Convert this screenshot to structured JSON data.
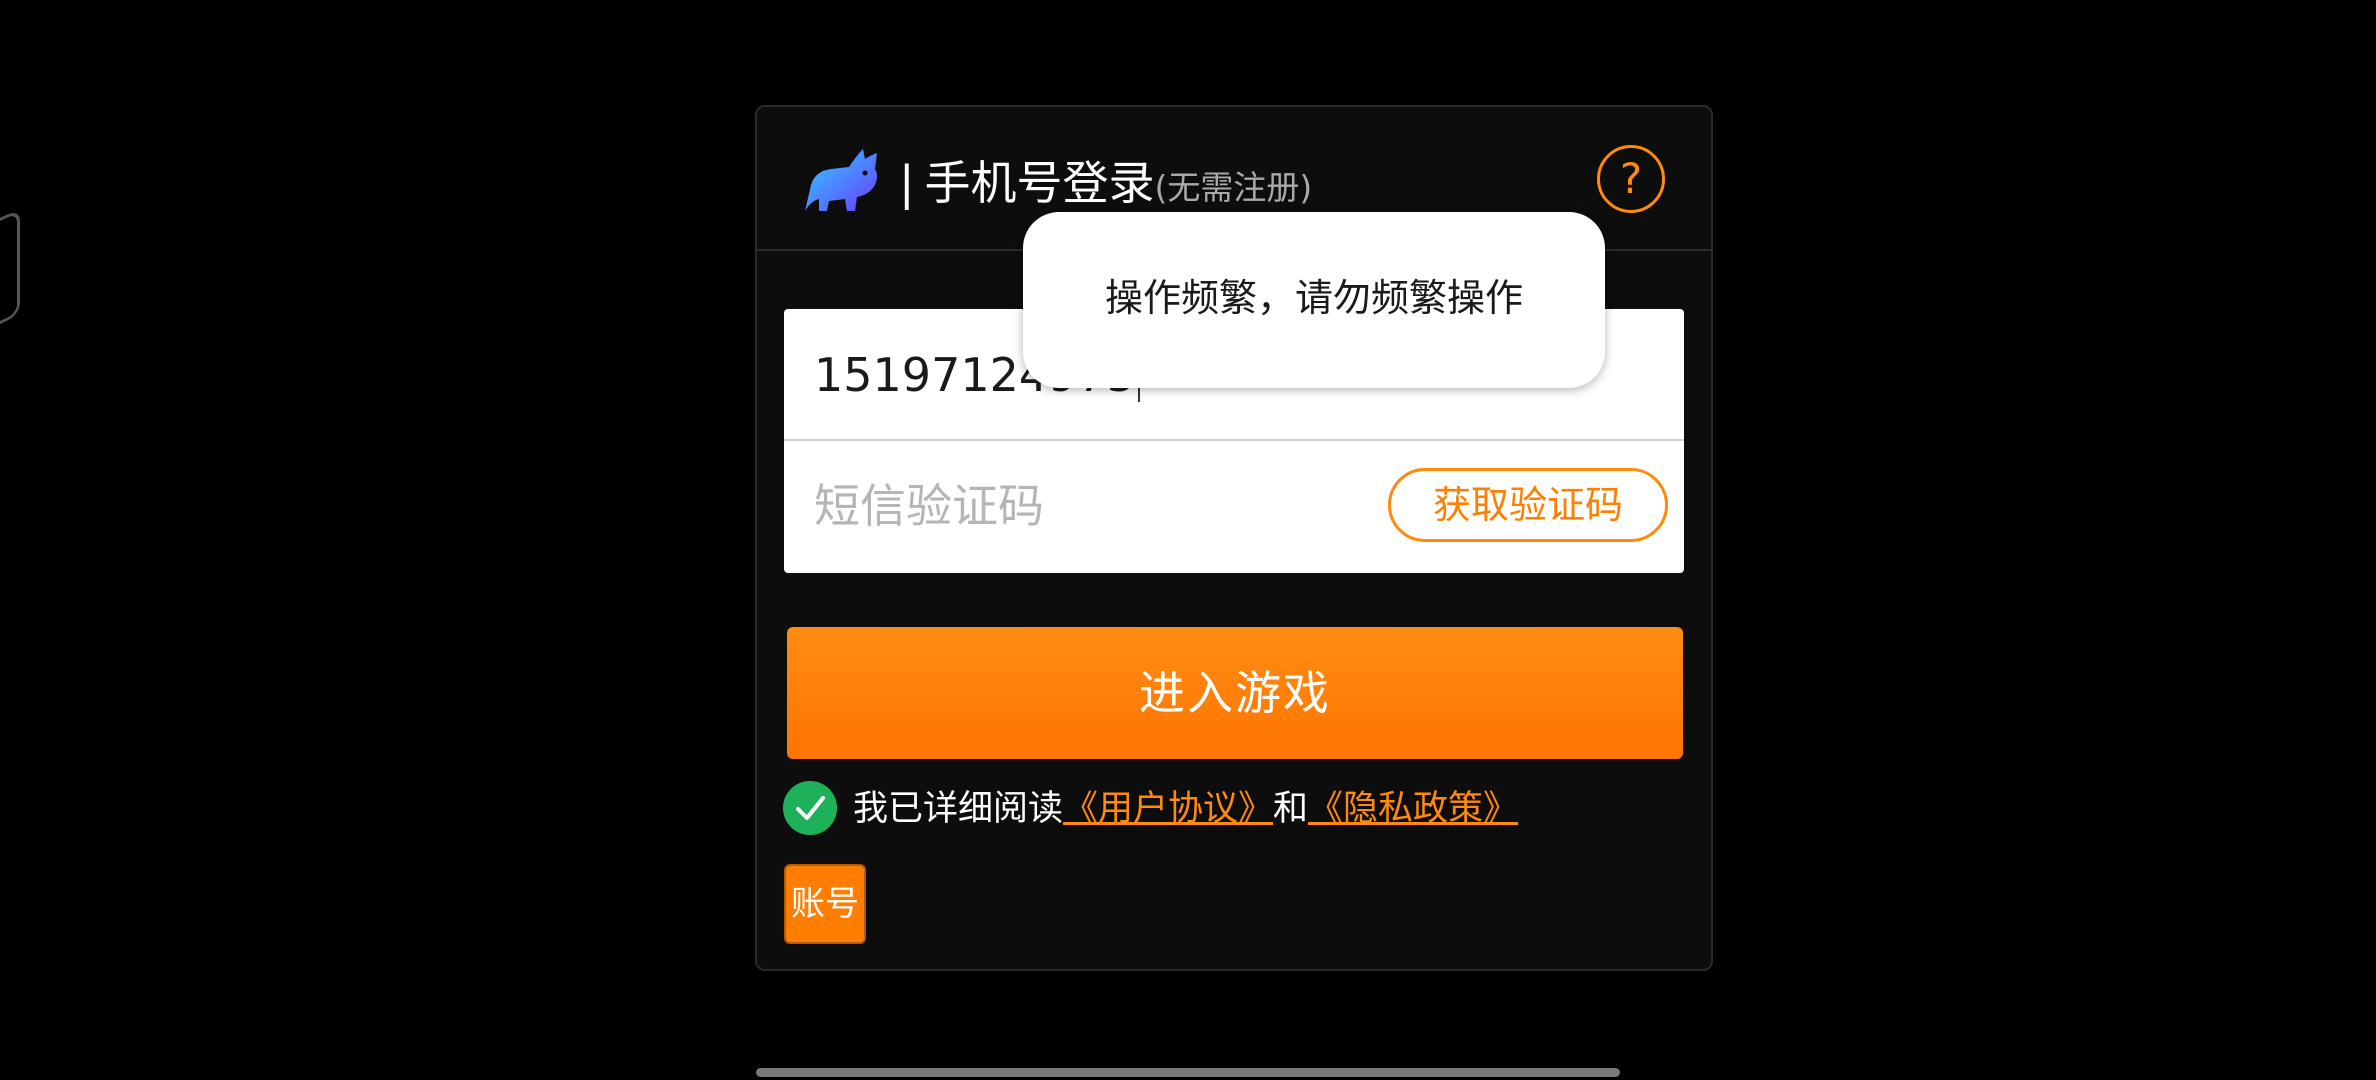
{
  "header": {
    "separator": "|",
    "title": "手机号登录",
    "subtitle": "(无需注册)",
    "help_symbol": "?"
  },
  "form": {
    "phone_value": "15197124975",
    "sms_code_placeholder": "短信验证码",
    "get_code_label": "获取验证码"
  },
  "enter_game_label": "进入游戏",
  "agreement": {
    "prefix": "我已详细阅读",
    "user_agreement": "《用户协议》",
    "conjunction": "和",
    "privacy_policy": "《隐私政策》",
    "checked": true
  },
  "account_button_label": "账号",
  "toast": {
    "message": "操作频繁，请勿频繁操作"
  },
  "colors": {
    "accent": "#ff8a0b",
    "check_green": "#1fb05a",
    "background": "#000000",
    "dialog_bg": "#0d0d0d"
  },
  "icons": {
    "logo": "rhino-logo-icon",
    "help": "question-circle-icon",
    "check": "check-circle-icon"
  }
}
